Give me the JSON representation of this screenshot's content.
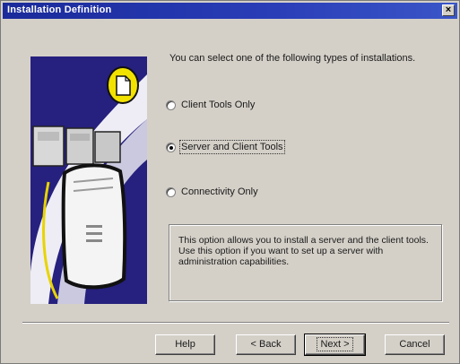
{
  "window": {
    "title": "Installation Definition",
    "close_glyph": "×"
  },
  "main": {
    "heading": "You can select one of the following types of installations.",
    "options": [
      {
        "label": "Client Tools Only",
        "checked": false
      },
      {
        "label": "Server and Client Tools",
        "checked": true
      },
      {
        "label": "Connectivity Only",
        "checked": false
      }
    ],
    "description": "This option allows you to install a server and the client tools. Use this option if you want to set up a server with administration capabilities."
  },
  "buttons": {
    "help": "Help",
    "back": "< Back",
    "next": "Next >",
    "cancel": "Cancel"
  },
  "colors": {
    "title_bar": "#1a2a9a",
    "illustration_background": "#26207e",
    "dialog_face": "#d4d0c8"
  }
}
